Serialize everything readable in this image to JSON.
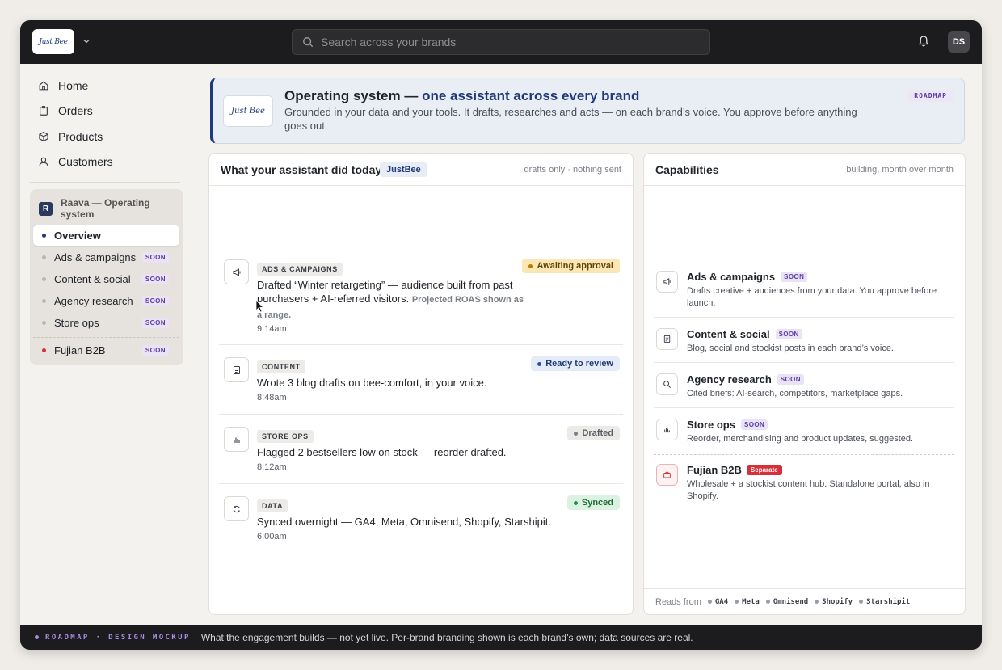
{
  "topbar": {
    "brand_logo_text": "Just Bee",
    "search_placeholder": "Search across your brands",
    "avatar_initials": "DS"
  },
  "nav": [
    {
      "label": "Home",
      "icon": "home-icon"
    },
    {
      "label": "Orders",
      "icon": "clipboard-icon"
    },
    {
      "label": "Products",
      "icon": "box-icon"
    },
    {
      "label": "Customers",
      "icon": "user-icon"
    }
  ],
  "subnav": {
    "badge": "R",
    "title": "Raava — Operating system",
    "items": [
      {
        "label": "Overview",
        "soon": ""
      },
      {
        "label": "Ads & campaigns",
        "soon": "SOON"
      },
      {
        "label": "Content & social",
        "soon": "SOON"
      },
      {
        "label": "Agency research",
        "soon": "SOON"
      },
      {
        "label": "Store ops",
        "soon": "SOON"
      },
      {
        "label": "Fujian B2B",
        "soon": "SOON"
      }
    ]
  },
  "banner": {
    "logo_text": "Just Bee",
    "title_lead": "Operating system — ",
    "title_accent": "one assistant across every brand",
    "subtitle": "Grounded in your data and your tools. It drafts, researches and acts — on each brand’s voice. You approve before anything goes out.",
    "tag": "ROADMAP"
  },
  "activity": {
    "title": "What your assistant did today",
    "brand": "JustBee",
    "meta": "drafts only · nothing sent",
    "items": [
      {
        "tag": "ADS & CAMPAIGNS",
        "icon": "megaphone-icon",
        "text": "Drafted “Winter retargeting” — audience built from past purchasers + AI-referred visitors.",
        "note": "Projected ROAS shown as a range.",
        "time": "9:14am",
        "status": "Awaiting approval"
      },
      {
        "tag": "CONTENT",
        "icon": "document-icon",
        "text": "Wrote 3 blog drafts on bee-comfort, in your voice.",
        "note": "",
        "time": "8:48am",
        "status": "Ready to review"
      },
      {
        "tag": "STORE OPS",
        "icon": "bar-chart-icon",
        "text": "Flagged 2 bestsellers low on stock — reorder drafted.",
        "note": "",
        "time": "8:12am",
        "status": "Drafted"
      },
      {
        "tag": "DATA",
        "icon": "refresh-icon",
        "text": "Synced overnight — GA4, Meta, Omnisend, Shopify, Starshipit.",
        "note": "",
        "time": "6:00am",
        "status": "Synced"
      }
    ]
  },
  "capabilities": {
    "title": "Capabilities",
    "meta": "building, month over month",
    "items": [
      {
        "name": "Ads & campaigns",
        "badge": "SOON",
        "icon": "megaphone-icon",
        "desc": "Drafts creative + audiences from your data. You approve before launch."
      },
      {
        "name": "Content & social",
        "badge": "SOON",
        "icon": "document-icon",
        "desc": "Blog, social and stockist posts in each brand’s voice."
      },
      {
        "name": "Agency research",
        "badge": "SOON",
        "icon": "search-icon",
        "desc": "Cited briefs: AI-search, competitors, marketplace gaps."
      },
      {
        "name": "Store ops",
        "badge": "SOON",
        "icon": "bar-chart-icon",
        "desc": "Reorder, merchandising and product updates, suggested."
      },
      {
        "name": "Fujian B2B",
        "badge": "Separate",
        "icon": "briefcase-icon",
        "desc": "Wholesale + a stockist content hub. Standalone portal, also in Shopify."
      }
    ],
    "reads_label": "Reads from",
    "sources": [
      "GA4",
      "Meta",
      "Omnisend",
      "Shopify",
      "Starshipit"
    ]
  },
  "footer": {
    "tag": "ROADMAP · DESIGN MOCKUP",
    "text": "What the engagement builds — not yet live. Per-brand branding shown is each brand’s own; data sources are real."
  },
  "colors": {
    "accent": "#1f3a7a",
    "soon_purple": "#5b3fa0",
    "fujian_red": "#d6303a",
    "topbar": "#1c1c1e"
  }
}
